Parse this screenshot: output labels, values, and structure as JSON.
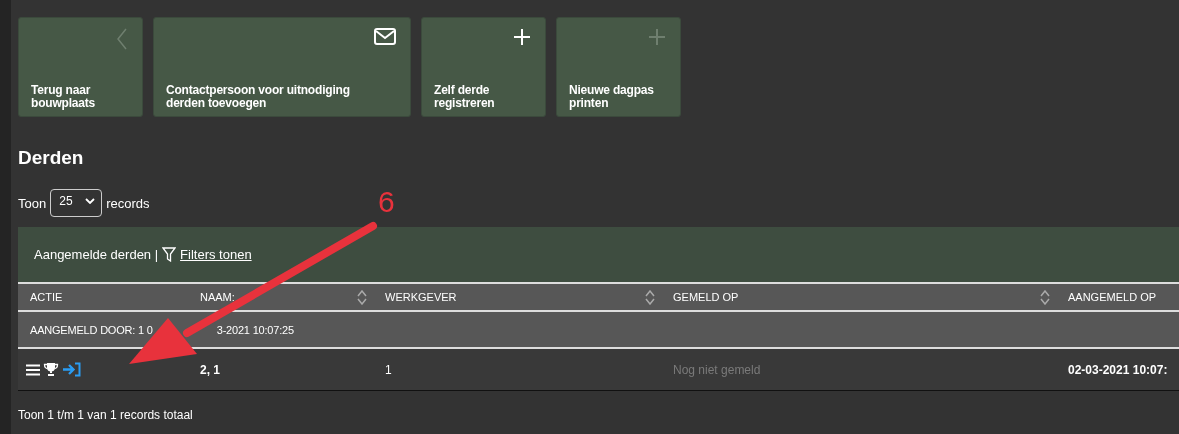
{
  "tiles": [
    {
      "label": "Terug naar\nbouwplaats",
      "kind": "back",
      "icon_muted": true,
      "wide": false
    },
    {
      "label": "Contactpersoon voor uitnodiging\nderden toevoegen",
      "kind": "mail",
      "icon_muted": false,
      "wide": true
    },
    {
      "label": "Zelf derde\nregistreren",
      "kind": "add",
      "icon_muted": false,
      "wide": false
    },
    {
      "label": "Nieuwe dagpas\nprinten",
      "kind": "add",
      "icon_muted": true,
      "wide": false
    }
  ],
  "heading": "Derden",
  "page_size": {
    "before": "Toon",
    "value": "25",
    "after": "records"
  },
  "table": {
    "title": "Aangemelde derden |",
    "filter_link": "Filters tonen",
    "columns": [
      {
        "label": "ACTIE",
        "sortable": false
      },
      {
        "label": "NAAM:",
        "sortable": true
      },
      {
        "label": "WERKGEVER",
        "sortable": true
      },
      {
        "label": "GEMELD OP",
        "sortable": true
      },
      {
        "label": "AANGEMELD OP",
        "sortable": false
      }
    ],
    "group": [
      "AANGEMELD DOOR: 1 0",
      "3-2021 10:07:25"
    ],
    "rows": [
      {
        "cells": [
          {
            "kind": "actions"
          },
          {
            "kind": "strong",
            "text": "2, 1"
          },
          {
            "kind": "text",
            "text": "1"
          },
          {
            "kind": "muted",
            "text": "Nog niet gemeld"
          },
          {
            "kind": "strong",
            "text": "02-03-2021 10:07:"
          }
        ]
      }
    ]
  },
  "footer": "Toon 1 t/m 1 van 1 records totaal",
  "annotation": {
    "label": "6"
  }
}
